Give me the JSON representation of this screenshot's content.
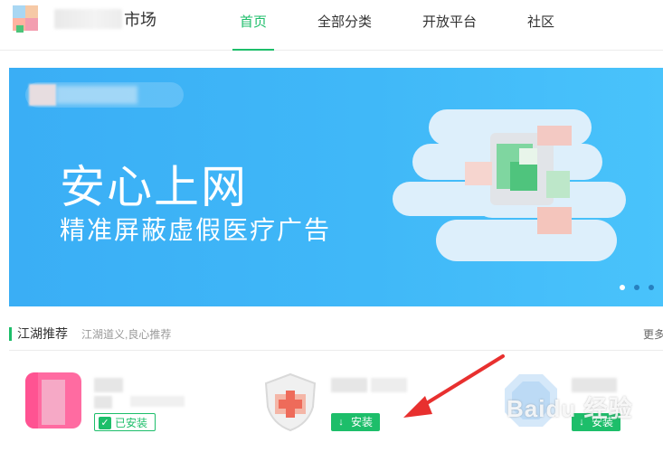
{
  "header": {
    "brand_suffix": "市场",
    "nav": [
      {
        "label": "首页",
        "active": true
      },
      {
        "label": "全部分类",
        "active": false
      },
      {
        "label": "开放平台",
        "active": false
      },
      {
        "label": "社区",
        "active": false
      }
    ]
  },
  "banner": {
    "title": "安心上网",
    "subtitle": "精准屏蔽虚假医疗广告",
    "slide_count": 3,
    "active_slide": 1
  },
  "section": {
    "title": "江湖推荐",
    "subtitle": "江湖道义,良心推荐",
    "more": "更多"
  },
  "apps": [
    {
      "button_label": "已安装",
      "state": "installed"
    },
    {
      "button_label": "安装",
      "state": "install"
    },
    {
      "button_label": "安装",
      "state": "install"
    }
  ],
  "watermark": "Baidu 经验",
  "colors": {
    "accent": "#1dbe6a",
    "banner": "#40b8f8",
    "arrow": "#e8302f"
  }
}
